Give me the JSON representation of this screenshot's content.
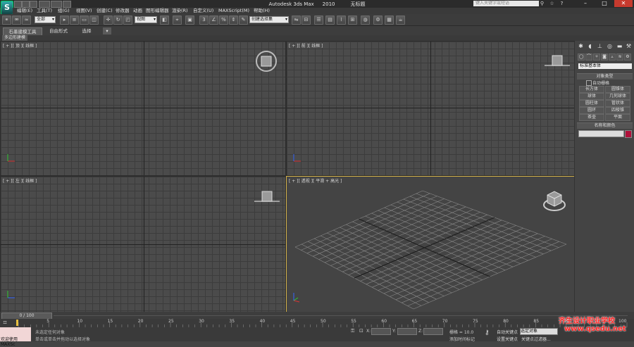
{
  "title_bar": {
    "app": "Autodesk 3ds Max",
    "version": "2010",
    "file": "无标题",
    "search_placeholder": "键入关键字或短语"
  },
  "menu": [
    "编辑(E)",
    "工具(T)",
    "组(G)",
    "视图(V)",
    "创建(C)",
    "修改器",
    "动画",
    "图形编辑器",
    "渲染(R)",
    "自定义(U)",
    "MAXScript(M)",
    "帮助(H)"
  ],
  "toolbar": {
    "selection_filter": "全部",
    "reference_coord": "视图",
    "named_selection": "创建选择集"
  },
  "ribbon": {
    "tabs": [
      "石墨建模工具",
      "自由形式",
      "选择"
    ],
    "subtab": "多边形建模"
  },
  "viewports": {
    "top": "[ + ][ 顶 ][ 线框 ]",
    "front": "[ + ][ 前 ][ 线框 ]",
    "left": "[ + ][ 左 ][ 线框 ]",
    "perspective": "[ + ][ 透视 ][ 平滑 + 高光 ]"
  },
  "command_panel": {
    "category": "标准基本体",
    "object_type_title": "对象类型",
    "autogrid": "自动栅格",
    "objects": [
      "长方体",
      "圆锥体",
      "球体",
      "几何球体",
      "圆柱体",
      "管状体",
      "圆环",
      "四棱锥",
      "茶壶",
      "平面"
    ],
    "name_color_title": "名称和颜色"
  },
  "timeline": {
    "slider": "0 / 100",
    "ticks": [
      "0",
      "5",
      "10",
      "15",
      "20",
      "25",
      "30",
      "35",
      "40",
      "45",
      "50",
      "55",
      "60",
      "65",
      "70",
      "75",
      "80",
      "85",
      "90",
      "95",
      "100"
    ]
  },
  "status": {
    "maxscript": "欢迎使用 MAXSc",
    "line1": "未选定任何对象",
    "line2": "单击或单击并拖动以选择对象",
    "grid": "栅格 = 10.0",
    "auto_key": "自动关键点",
    "set_key": "设置关键点",
    "selected_object": "选定对象",
    "key_filters": "关键点过滤器...",
    "add_time_tag": "添加时间标记"
  },
  "watermark": {
    "line1": "齐生设计职业学校",
    "line2": "www.qsedu.net"
  },
  "colors": {
    "active_viewport_border": "#d4b24a",
    "object_color_swatch": "#b0103a",
    "watermark": "#ff2222"
  }
}
